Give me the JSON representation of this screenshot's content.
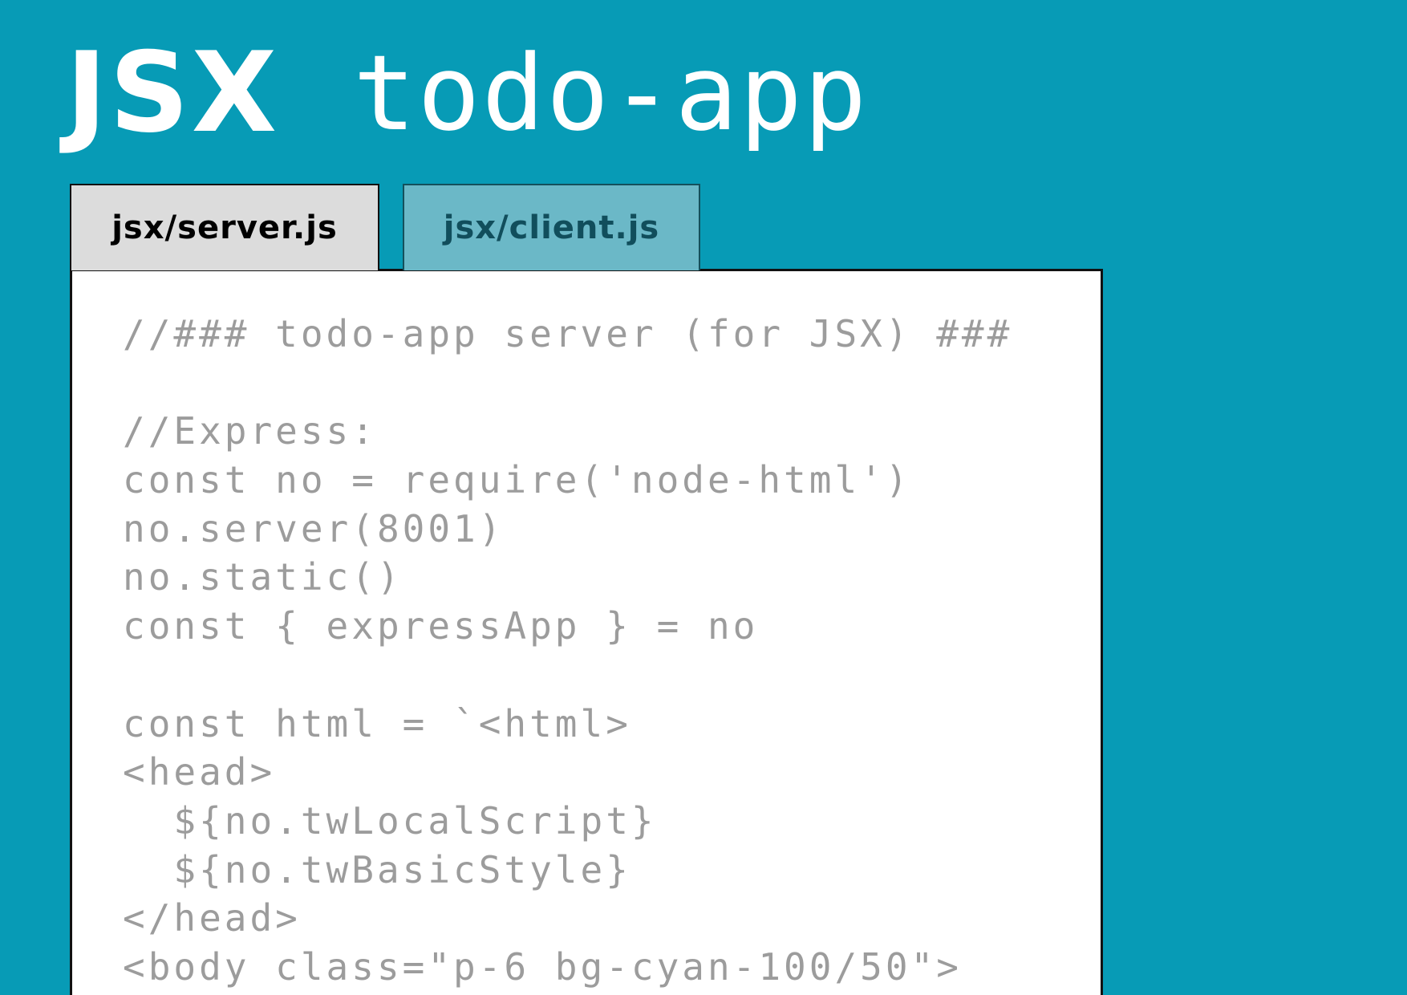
{
  "title": {
    "strong": "JSX",
    "light": "todo-app"
  },
  "tabs": [
    {
      "label": "jsx/server.js",
      "active": true
    },
    {
      "label": "jsx/client.js",
      "active": false
    }
  ],
  "code": {
    "lines": [
      "//### todo-app server (for JSX) ###",
      "",
      "//Express:",
      "const no = require('node-html')",
      "no.server(8001)",
      "no.static()",
      "const { expressApp } = no",
      "",
      "const html = `<html>",
      "<head>",
      "  ${no.twLocalScript}",
      "  ${no.twBasicStyle}",
      "</head>",
      "<body class=\"p-6 bg-cyan-100/50\">"
    ]
  },
  "colors": {
    "background": "#079bb6",
    "active_tab": "#dcdcdc",
    "inactive_tab": "#6bb8c7",
    "inactive_tab_text": "#114e5c",
    "code_text": "#9c9c9c"
  }
}
